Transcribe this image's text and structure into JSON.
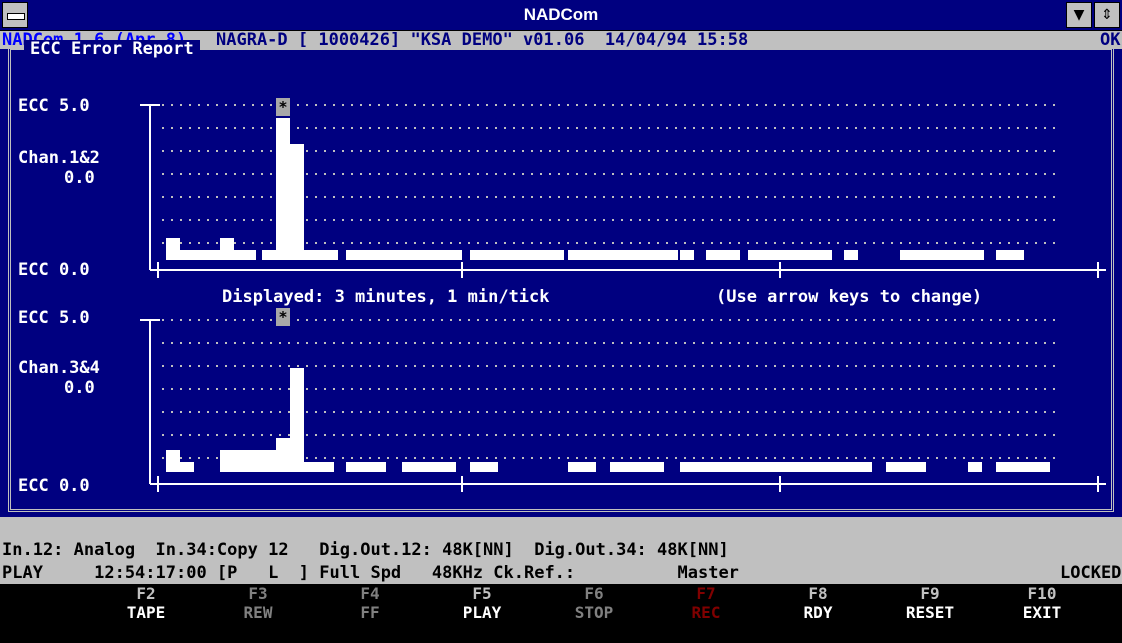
{
  "window": {
    "title": "NADCom"
  },
  "statusline": {
    "left": "NADCom 1.6 (Apr 8)",
    "right": "NAGRA-D [ 1000426] \"KSA DEMO\" v01.06  14/04/94 15:58",
    "ok": "OK"
  },
  "report": {
    "title": "ECC Error Report",
    "top_max": "ECC 5.0",
    "top_chan": "Chan.1&2",
    "top_val": "0.0",
    "top_min": "ECC 0.0",
    "displayed": "Displayed: 3 minutes, 1 min/tick",
    "hint": "(Use arrow keys to change)",
    "bot_max": "ECC 5.0",
    "bot_chan": "Chan.3&4",
    "bot_val": "0.0",
    "bot_min": "ECC 0.0",
    "marker": "*"
  },
  "bottom": {
    "line1": "In.12: Analog  In.34:Copy 12   Dig.Out.12: 48K[NN]  Dig.Out.34: 48K[NN]",
    "line2_left": "PLAY     12:54:17:00 [P   L  ] Full Spd   48KHz Ck.Ref.:          Master",
    "line2_right": "LOCKED"
  },
  "fkeys": [
    {
      "key": "F2",
      "label": "TAPE",
      "state": "normal"
    },
    {
      "key": "F3",
      "label": "REW",
      "state": "dim"
    },
    {
      "key": "F4",
      "label": "FF",
      "state": "dim"
    },
    {
      "key": "F5",
      "label": "PLAY",
      "state": "normal"
    },
    {
      "key": "F6",
      "label": "STOP",
      "state": "dim"
    },
    {
      "key": "F7",
      "label": "REC",
      "state": "rec"
    },
    {
      "key": "F8",
      "label": "RDY",
      "state": "normal"
    },
    {
      "key": "F9",
      "label": "RESET",
      "state": "normal"
    },
    {
      "key": "F10",
      "label": "EXIT",
      "state": "normal"
    }
  ],
  "colors": {
    "background": "#000080",
    "panel": "#c0c0c0",
    "bars": "#ffffff",
    "rec": "#800000"
  }
}
